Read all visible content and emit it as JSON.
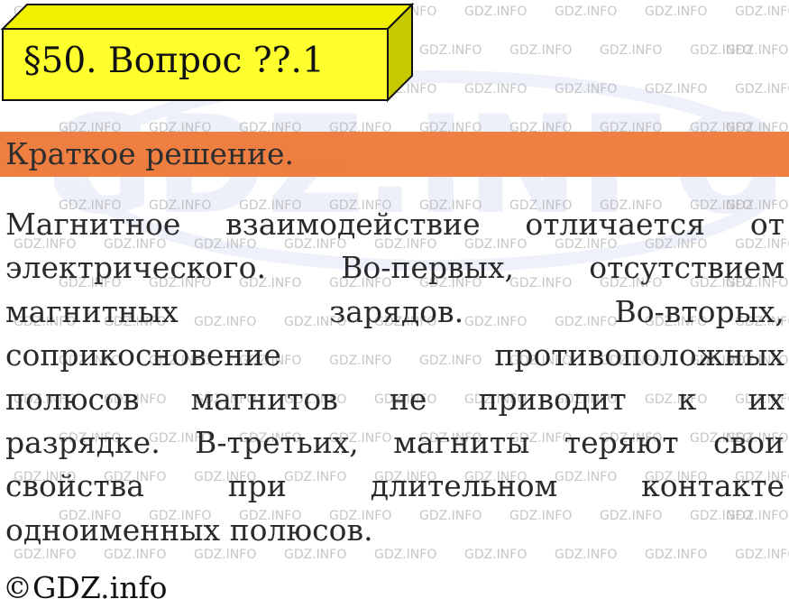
{
  "title": "§50. Вопрос ??.1",
  "section_label": "Краткое решение.",
  "answer_lines": [
    [
      "Магнитное",
      "взаимодействие",
      "отличается",
      "от"
    ],
    [
      "электрического.",
      "Во-первых,",
      "отсутствием"
    ],
    [
      "магнитных",
      "зарядов.",
      "Во-вторых,"
    ],
    [
      "соприкосновение",
      "противоположных"
    ],
    [
      "полюсов",
      "магнитов",
      "не",
      "приводит",
      "к",
      "их"
    ],
    [
      "разрядке.",
      "В-третьих,",
      "магниты",
      "теряют",
      "свои"
    ],
    [
      "свойства",
      "при",
      "длительном",
      "контакте"
    ],
    [
      "одноименных полюсов."
    ]
  ],
  "copyright": "©GDZ.info",
  "watermark": {
    "tile_text": "GDZ.INFO",
    "big_text": "GDZ.INFO"
  },
  "colors": {
    "title_box_front": "#ffff2e",
    "title_box_top": "#f0f000",
    "title_box_side": "#c8c800",
    "band": "#ef7836"
  }
}
